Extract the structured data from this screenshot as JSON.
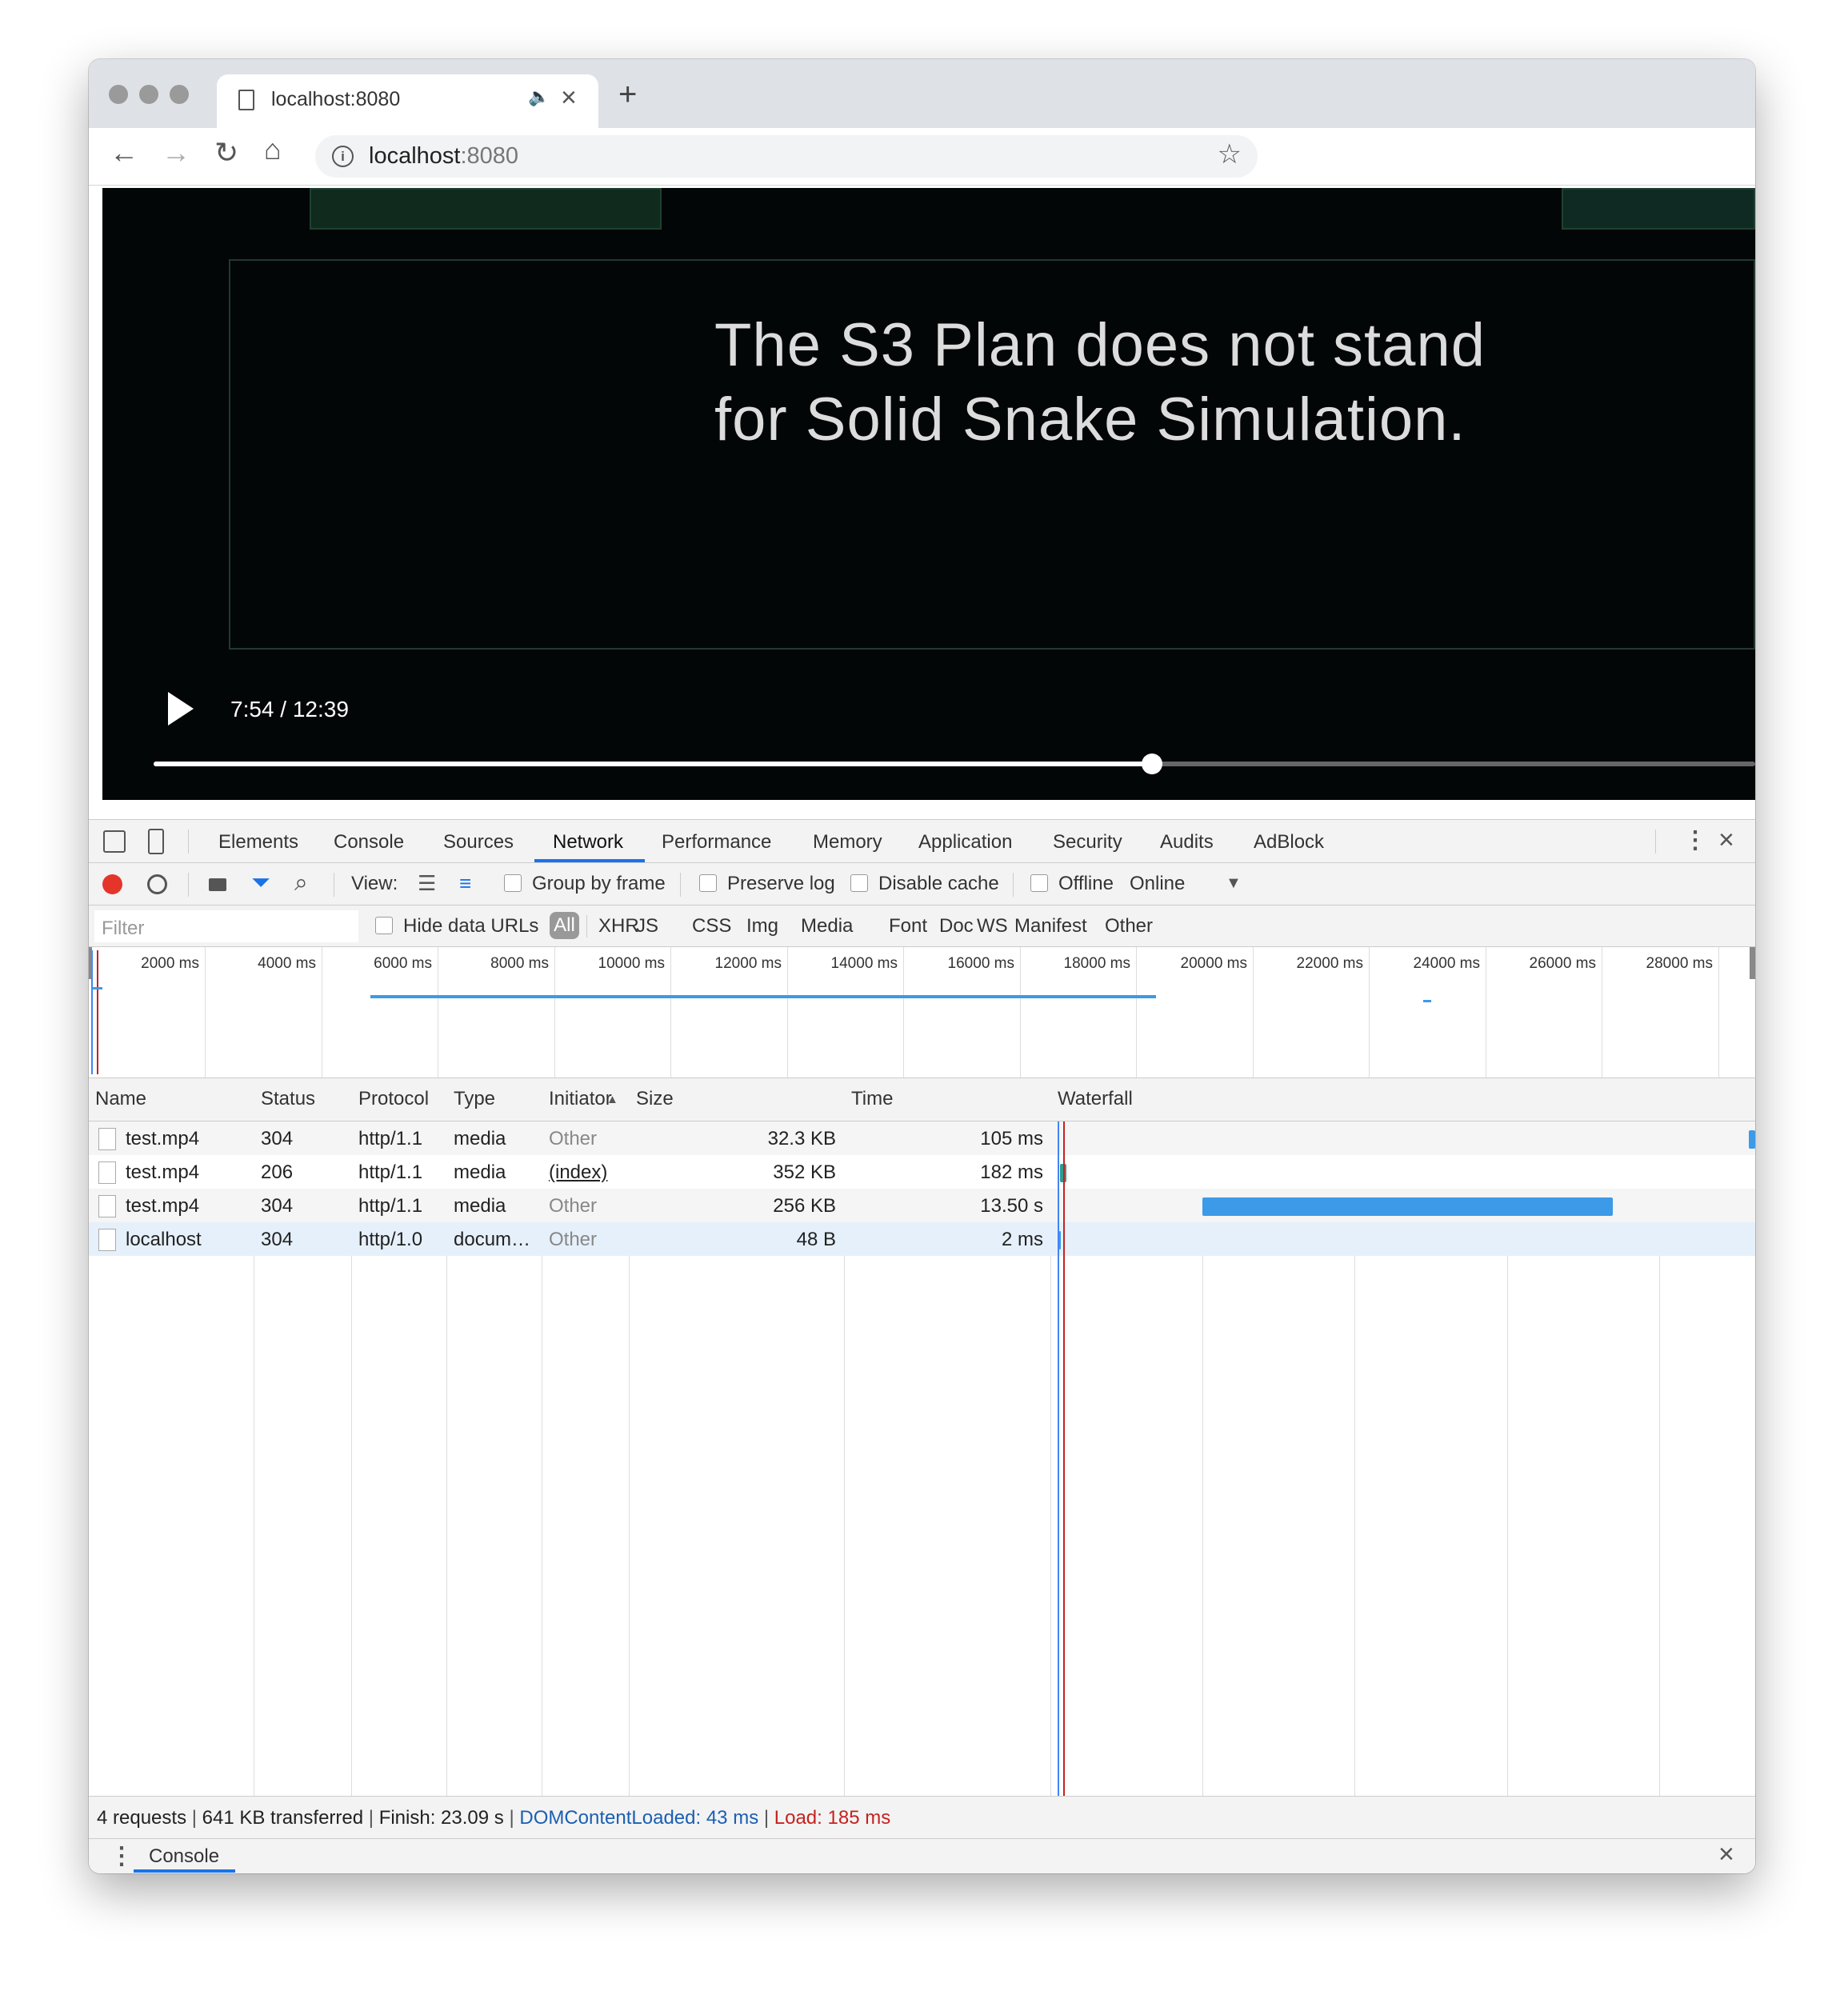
{
  "tab": {
    "title": "localhost:8080",
    "close_icon": "×"
  },
  "omnibox": {
    "host": "localhost",
    "port": ":8080"
  },
  "video": {
    "subtitle": "The S3 Plan does not stand\nfor Solid Snake Simulation.",
    "timecode": "7:54 / 12:39",
    "progress_fraction": 0.6235
  },
  "devtools": {
    "tabs": [
      "Elements",
      "Console",
      "Sources",
      "Network",
      "Performance",
      "Memory",
      "Application",
      "Security",
      "Audits",
      "AdBlock"
    ],
    "active_tab": "Network",
    "controls": {
      "view_label": "View:",
      "group_by_frame": "Group by frame",
      "preserve_log": "Preserve log",
      "disable_cache": "Disable cache",
      "offline": "Offline",
      "throttle": "Online"
    },
    "filter": {
      "placeholder": "Filter",
      "hide_data_urls": "Hide data URLs",
      "types": [
        "All",
        "XHR",
        "JS",
        "CSS",
        "Img",
        "Media",
        "Font",
        "Doc",
        "WS",
        "Manifest",
        "Other"
      ]
    },
    "overview_ticks": [
      "2000 ms",
      "4000 ms",
      "6000 ms",
      "8000 ms",
      "10000 ms",
      "12000 ms",
      "14000 ms",
      "16000 ms",
      "18000 ms",
      "20000 ms",
      "22000 ms",
      "24000 ms",
      "26000 ms",
      "28000 ms"
    ],
    "columns": [
      "Name",
      "Status",
      "Protocol",
      "Type",
      "Initiator",
      "Size",
      "Time",
      "Waterfall"
    ],
    "rows": [
      {
        "name": "test.mp4",
        "status": "304",
        "protocol": "http/1.1",
        "type": "media",
        "initiator": "Other",
        "size": "32.3 KB",
        "time": "105 ms"
      },
      {
        "name": "test.mp4",
        "status": "206",
        "protocol": "http/1.1",
        "type": "media",
        "initiator": "(index)",
        "size": "352 KB",
        "time": "182 ms"
      },
      {
        "name": "test.mp4",
        "status": "304",
        "protocol": "http/1.1",
        "type": "media",
        "initiator": "Other",
        "size": "256 KB",
        "time": "13.50 s"
      },
      {
        "name": "localhost",
        "status": "304",
        "protocol": "http/1.0",
        "type": "docum…",
        "initiator": "Other",
        "size": "48 B",
        "time": "2 ms"
      }
    ],
    "summary": {
      "requests": "4 requests",
      "transferred": "641 KB transferred",
      "finish": "Finish: 23.09 s",
      "dcl": "DOMContentLoaded: 43 ms",
      "load": "Load: 185 ms",
      "dcl_color": "#1a5fb4",
      "load_color": "#c5221f"
    },
    "drawer_tab": "Console"
  },
  "colors": {
    "accent": "#1a73e8",
    "record": "#e5352b",
    "waterfall": "#3c9ae8"
  },
  "icons": [
    "doc-icon",
    "audio-icon",
    "close-icon",
    "plus-icon",
    "back-icon",
    "forward-icon",
    "reload-icon",
    "home-icon",
    "info-icon",
    "star-icon",
    "play-icon",
    "inspect-icon",
    "device-icon",
    "more-icon",
    "record-icon",
    "clear-icon",
    "camera-icon",
    "filter-icon",
    "search-icon",
    "list-view-icon",
    "waterfall-view-icon",
    "dropdown-icon",
    "sort-icon",
    "file-icon"
  ]
}
